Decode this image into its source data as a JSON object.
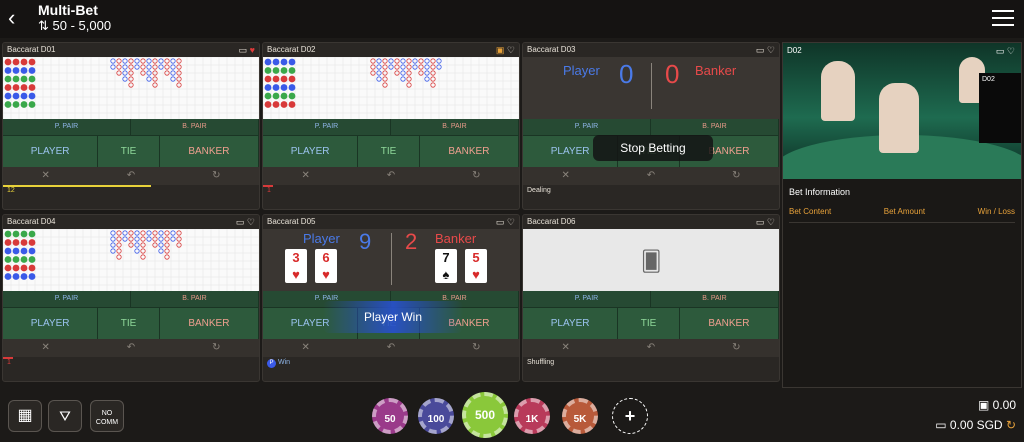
{
  "header": {
    "title": "Multi-Bet",
    "range": "⇅ 50 - 5,000"
  },
  "labels": {
    "p_pair": "P. PAIR",
    "b_pair": "B. PAIR",
    "player": "PLAYER",
    "tie": "TIE",
    "banker": "BANKER"
  },
  "tables": [
    {
      "name": "Baccarat D01",
      "footer": "12",
      "progress": 0.55,
      "progress_color": "#e8d23a"
    },
    {
      "name": "Baccarat D02",
      "footer": "1",
      "progress": 0.04,
      "progress_color": "#d83a3a"
    },
    {
      "name": "Baccarat D03",
      "footer": "Dealing",
      "status": "Stop Betting",
      "player_label": "Player",
      "player_score": "0",
      "banker_label": "Banker",
      "banker_score": "0"
    },
    {
      "name": "Baccarat D04",
      "footer": "1",
      "progress": 0.04,
      "progress_color": "#d83a3a"
    },
    {
      "name": "Baccarat D05",
      "footer": "Win",
      "footer_badge": "P",
      "status": "Player Win",
      "player_label": "Player",
      "player_score": "9",
      "banker_label": "Banker",
      "banker_score": "2",
      "player_cards": [
        "3",
        "6"
      ],
      "banker_cards": [
        "7",
        "5"
      ]
    },
    {
      "name": "Baccarat D06",
      "footer": "Shuffling"
    }
  ],
  "video": {
    "label": "D02",
    "board": "D02"
  },
  "bet_info": {
    "title": "Bet Information",
    "col1": "Bet Content",
    "col2": "Bet Amount",
    "col3": "Win / Loss"
  },
  "bottom": {
    "no_comm": "NO COMM",
    "balance1": "0.00",
    "balance2": "0.00 SGD"
  },
  "chips": [
    {
      "label": "50",
      "color": "#9a3a8a"
    },
    {
      "label": "100",
      "color": "#4a4a9a"
    },
    {
      "label": "500",
      "color": "#8ac83a"
    },
    {
      "label": "1K",
      "color": "#b83a5a"
    },
    {
      "label": "5K",
      "color": "#b85a3a"
    }
  ]
}
